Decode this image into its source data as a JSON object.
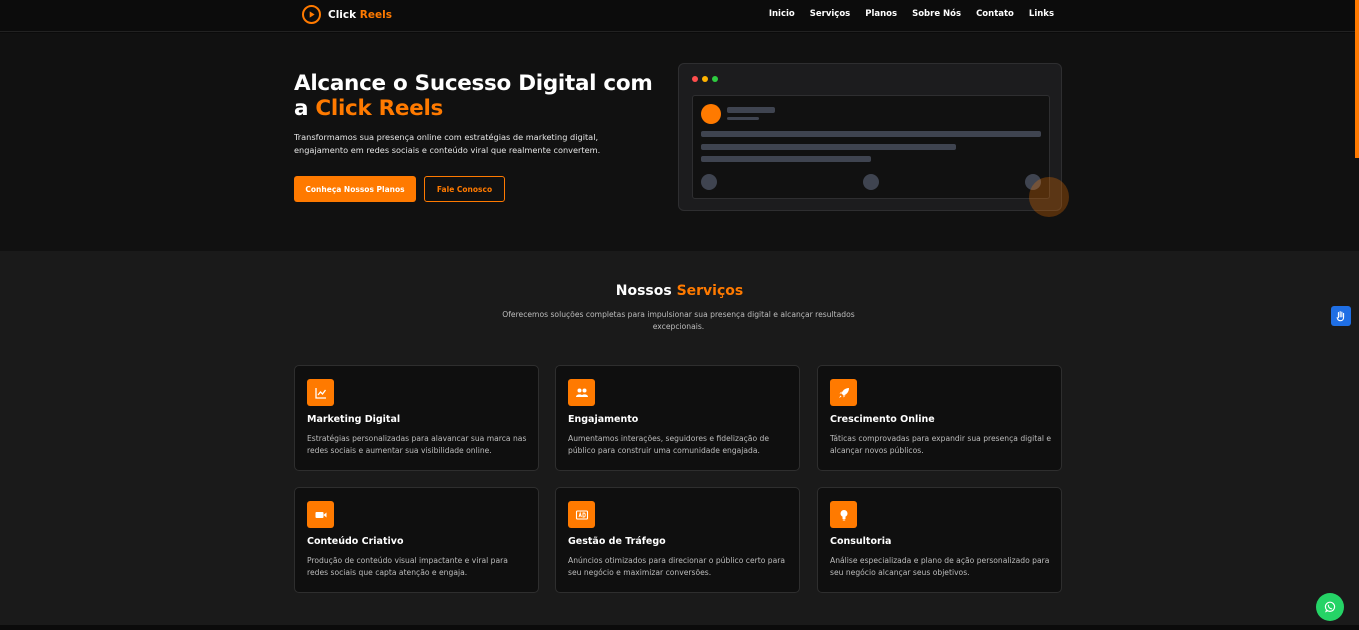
{
  "nav": {
    "logo": {
      "brand_main": "Click",
      "brand_accent": "Reels"
    },
    "links": [
      "Inicio",
      "Serviços",
      "Planos",
      "Sobre Nós",
      "Contato",
      "Links"
    ]
  },
  "hero": {
    "title_line1": "Alcance o Sucesso Digital com",
    "title_prefix": "a ",
    "title_accent": "Click Reels",
    "subtitle": "Transformamos sua presença online com estratégias de marketing digital, engajamento em redes sociais e conteúdo viral que realmente convertem.",
    "primary_button": "Conheça Nossos Planos",
    "secondary_button": "Fale Conosco"
  },
  "services": {
    "title_main": "Nossos ",
    "title_accent": "Serviços",
    "subtitle": "Oferecemos soluções completas para impulsionar sua presença digital e alcançar resultados excepcionais.",
    "cards": [
      {
        "icon": "chart-line-icon",
        "title": "Marketing Digital",
        "description": "Estratégias personalizadas para alavancar sua marca nas redes sociais e aumentar sua visibilidade online."
      },
      {
        "icon": "users-icon",
        "title": "Engajamento",
        "description": "Aumentamos interações, seguidores e fidelização de público para construir uma comunidade engajada."
      },
      {
        "icon": "rocket-icon",
        "title": "Crescimento Online",
        "description": "Táticas comprovadas para expandir sua presença digital e alcançar novos públicos."
      },
      {
        "icon": "video-camera-icon",
        "title": "Conteúdo Criativo",
        "description": "Produção de conteúdo visual impactante e viral para redes sociais que capta atenção e engaja."
      },
      {
        "icon": "ad-icon",
        "title": "Gestão de Tráfego",
        "description": "Anúncios otimizados para direcionar o público certo para seu negócio e maximizar conversões."
      },
      {
        "icon": "lightbulb-icon",
        "title": "Consultoria",
        "description": "Análise especializada e plano de ação personalizado para seu negócio alcançar seus objetivos."
      }
    ]
  },
  "colors": {
    "accent": "#ff7a00",
    "accessibility": "#1f6fe5",
    "whatsapp": "#25d366"
  }
}
